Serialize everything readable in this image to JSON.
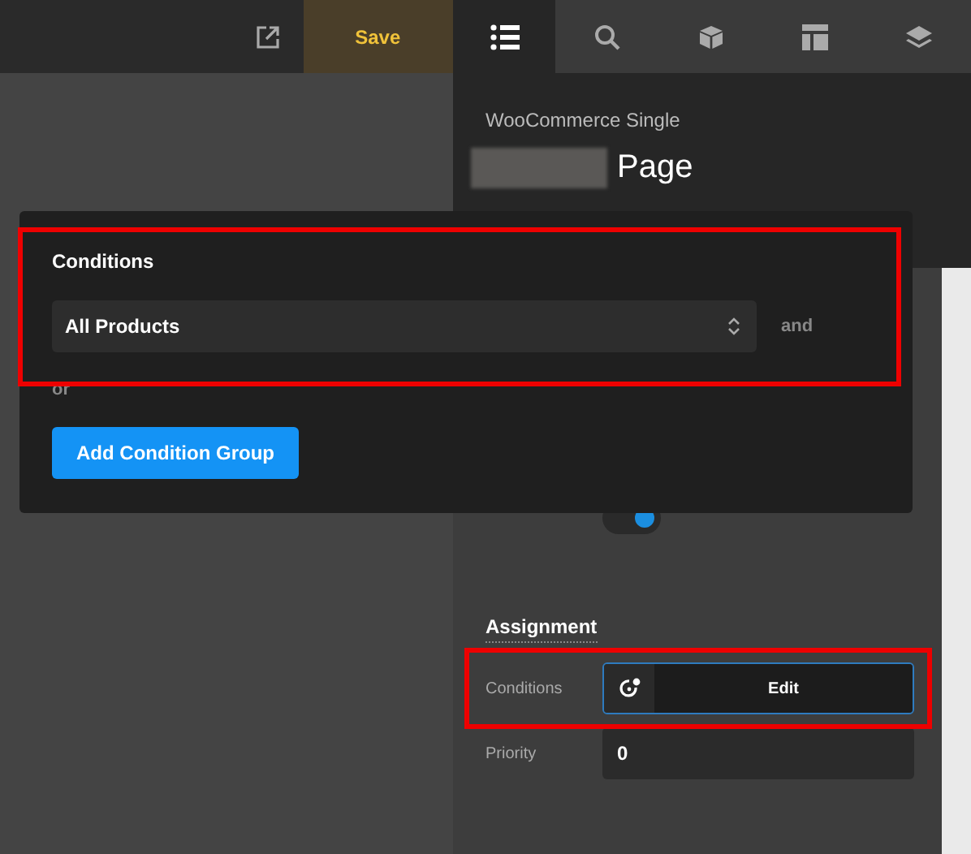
{
  "toolbar": {
    "save": "Save",
    "tabs": [
      {
        "selected": true
      },
      {
        "selected": false
      },
      {
        "selected": false
      },
      {
        "selected": false
      },
      {
        "selected": false
      }
    ]
  },
  "panel": {
    "subtitle": "WooCommerce Single",
    "title": "Page",
    "footer": {
      "on": true
    },
    "assignment": {
      "heading": "Assignment",
      "conditions_label": "Conditions",
      "edit": "Edit",
      "priority_label": "Priority",
      "priority": "0"
    }
  },
  "popup": {
    "heading": "Conditions",
    "select": "All Products",
    "and": "and",
    "or": "or",
    "button": "Add Condition Group"
  }
}
